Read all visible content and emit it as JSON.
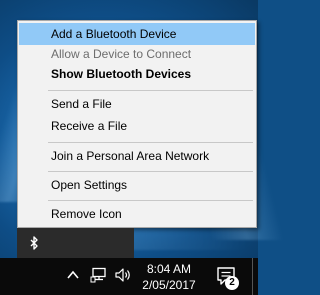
{
  "context_menu": {
    "items": [
      {
        "label": "Add a Bluetooth Device",
        "state": "highlighted"
      },
      {
        "label": "Allow a Device to Connect",
        "state": "disabled"
      },
      {
        "label": "Show Bluetooth Devices",
        "state": "bold"
      },
      {
        "label": "Send a File",
        "state": "normal"
      },
      {
        "label": "Receive a File",
        "state": "normal"
      },
      {
        "label": "Join a Personal Area Network",
        "state": "normal"
      },
      {
        "label": "Open Settings",
        "state": "normal"
      },
      {
        "label": "Remove Icon",
        "state": "normal"
      }
    ]
  },
  "tray_overflow": {
    "icons": [
      "bluetooth-icon"
    ]
  },
  "taskbar": {
    "icons": [
      "chevron-up-icon",
      "network-icon",
      "volume-icon",
      "action-center-icon"
    ],
    "time": "8:04 AM",
    "date": "2/05/2017",
    "notification_count": "2"
  },
  "colors": {
    "highlight": "#91c9f7",
    "menu_bg": "#f2f2f2",
    "taskbar_bg": "#0a0a0a",
    "desktop_bg": "#1b6bb0"
  }
}
